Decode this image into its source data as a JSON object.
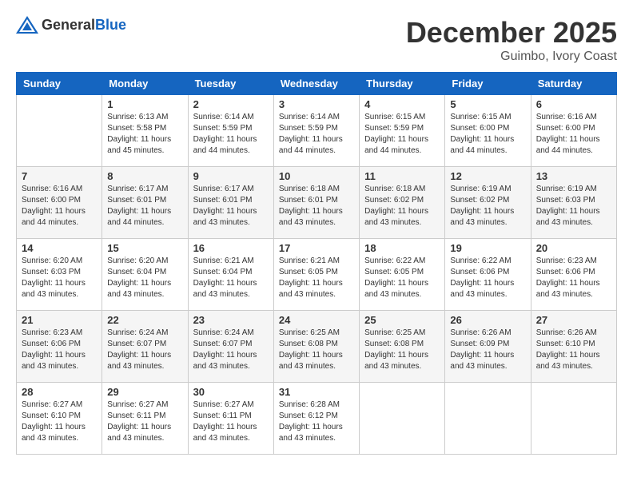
{
  "header": {
    "logo_general": "General",
    "logo_blue": "Blue",
    "month": "December 2025",
    "location": "Guimbo, Ivory Coast"
  },
  "days_of_week": [
    "Sunday",
    "Monday",
    "Tuesday",
    "Wednesday",
    "Thursday",
    "Friday",
    "Saturday"
  ],
  "weeks": [
    [
      {
        "day": "",
        "info": ""
      },
      {
        "day": "1",
        "info": "Sunrise: 6:13 AM\nSunset: 5:58 PM\nDaylight: 11 hours\nand 45 minutes."
      },
      {
        "day": "2",
        "info": "Sunrise: 6:14 AM\nSunset: 5:59 PM\nDaylight: 11 hours\nand 44 minutes."
      },
      {
        "day": "3",
        "info": "Sunrise: 6:14 AM\nSunset: 5:59 PM\nDaylight: 11 hours\nand 44 minutes."
      },
      {
        "day": "4",
        "info": "Sunrise: 6:15 AM\nSunset: 5:59 PM\nDaylight: 11 hours\nand 44 minutes."
      },
      {
        "day": "5",
        "info": "Sunrise: 6:15 AM\nSunset: 6:00 PM\nDaylight: 11 hours\nand 44 minutes."
      },
      {
        "day": "6",
        "info": "Sunrise: 6:16 AM\nSunset: 6:00 PM\nDaylight: 11 hours\nand 44 minutes."
      }
    ],
    [
      {
        "day": "7",
        "info": "Sunrise: 6:16 AM\nSunset: 6:00 PM\nDaylight: 11 hours\nand 44 minutes."
      },
      {
        "day": "8",
        "info": "Sunrise: 6:17 AM\nSunset: 6:01 PM\nDaylight: 11 hours\nand 44 minutes."
      },
      {
        "day": "9",
        "info": "Sunrise: 6:17 AM\nSunset: 6:01 PM\nDaylight: 11 hours\nand 43 minutes."
      },
      {
        "day": "10",
        "info": "Sunrise: 6:18 AM\nSunset: 6:01 PM\nDaylight: 11 hours\nand 43 minutes."
      },
      {
        "day": "11",
        "info": "Sunrise: 6:18 AM\nSunset: 6:02 PM\nDaylight: 11 hours\nand 43 minutes."
      },
      {
        "day": "12",
        "info": "Sunrise: 6:19 AM\nSunset: 6:02 PM\nDaylight: 11 hours\nand 43 minutes."
      },
      {
        "day": "13",
        "info": "Sunrise: 6:19 AM\nSunset: 6:03 PM\nDaylight: 11 hours\nand 43 minutes."
      }
    ],
    [
      {
        "day": "14",
        "info": "Sunrise: 6:20 AM\nSunset: 6:03 PM\nDaylight: 11 hours\nand 43 minutes."
      },
      {
        "day": "15",
        "info": "Sunrise: 6:20 AM\nSunset: 6:04 PM\nDaylight: 11 hours\nand 43 minutes."
      },
      {
        "day": "16",
        "info": "Sunrise: 6:21 AM\nSunset: 6:04 PM\nDaylight: 11 hours\nand 43 minutes."
      },
      {
        "day": "17",
        "info": "Sunrise: 6:21 AM\nSunset: 6:05 PM\nDaylight: 11 hours\nand 43 minutes."
      },
      {
        "day": "18",
        "info": "Sunrise: 6:22 AM\nSunset: 6:05 PM\nDaylight: 11 hours\nand 43 minutes."
      },
      {
        "day": "19",
        "info": "Sunrise: 6:22 AM\nSunset: 6:06 PM\nDaylight: 11 hours\nand 43 minutes."
      },
      {
        "day": "20",
        "info": "Sunrise: 6:23 AM\nSunset: 6:06 PM\nDaylight: 11 hours\nand 43 minutes."
      }
    ],
    [
      {
        "day": "21",
        "info": "Sunrise: 6:23 AM\nSunset: 6:06 PM\nDaylight: 11 hours\nand 43 minutes."
      },
      {
        "day": "22",
        "info": "Sunrise: 6:24 AM\nSunset: 6:07 PM\nDaylight: 11 hours\nand 43 minutes."
      },
      {
        "day": "23",
        "info": "Sunrise: 6:24 AM\nSunset: 6:07 PM\nDaylight: 11 hours\nand 43 minutes."
      },
      {
        "day": "24",
        "info": "Sunrise: 6:25 AM\nSunset: 6:08 PM\nDaylight: 11 hours\nand 43 minutes."
      },
      {
        "day": "25",
        "info": "Sunrise: 6:25 AM\nSunset: 6:08 PM\nDaylight: 11 hours\nand 43 minutes."
      },
      {
        "day": "26",
        "info": "Sunrise: 6:26 AM\nSunset: 6:09 PM\nDaylight: 11 hours\nand 43 minutes."
      },
      {
        "day": "27",
        "info": "Sunrise: 6:26 AM\nSunset: 6:10 PM\nDaylight: 11 hours\nand 43 minutes."
      }
    ],
    [
      {
        "day": "28",
        "info": "Sunrise: 6:27 AM\nSunset: 6:10 PM\nDaylight: 11 hours\nand 43 minutes."
      },
      {
        "day": "29",
        "info": "Sunrise: 6:27 AM\nSunset: 6:11 PM\nDaylight: 11 hours\nand 43 minutes."
      },
      {
        "day": "30",
        "info": "Sunrise: 6:27 AM\nSunset: 6:11 PM\nDaylight: 11 hours\nand 43 minutes."
      },
      {
        "day": "31",
        "info": "Sunrise: 6:28 AM\nSunset: 6:12 PM\nDaylight: 11 hours\nand 43 minutes."
      },
      {
        "day": "",
        "info": ""
      },
      {
        "day": "",
        "info": ""
      },
      {
        "day": "",
        "info": ""
      }
    ]
  ]
}
